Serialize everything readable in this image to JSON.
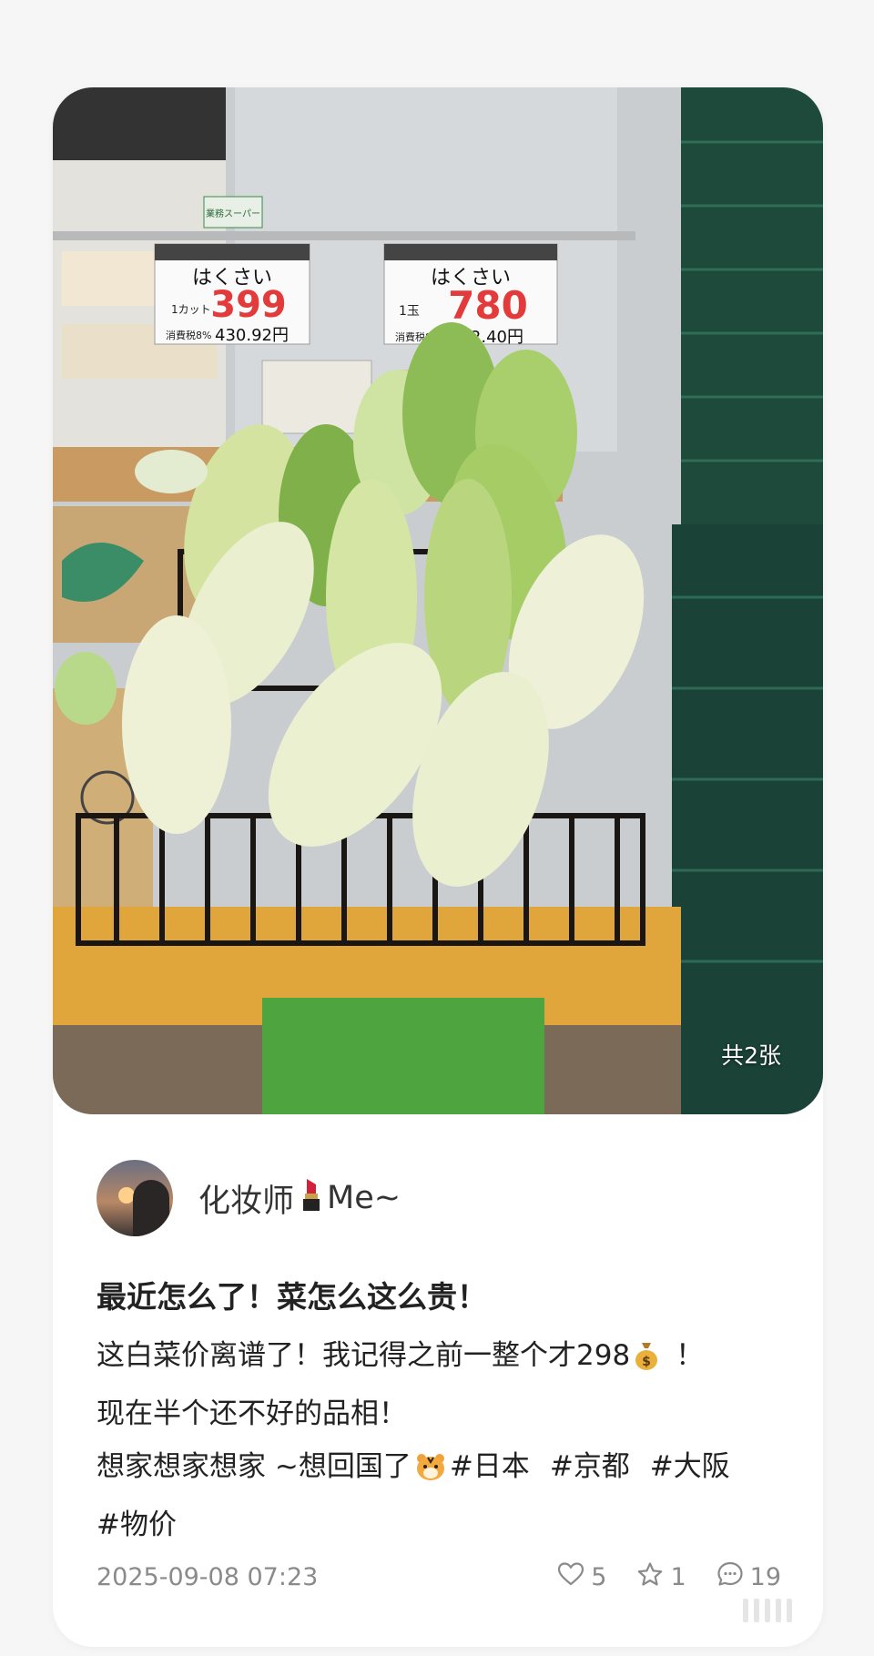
{
  "photo": {
    "count_label": "共2张",
    "price_tags": [
      {
        "name": "はくさい",
        "unit": "1カット",
        "price": "399",
        "tax_label": "消費税8%",
        "tax_price": "430.92円"
      },
      {
        "name": "はくさい",
        "unit": "1玉",
        "price": "780",
        "tax_label": "消費税8%",
        "tax_price": "842.40円"
      }
    ],
    "store_sign": "業務スーパー"
  },
  "author": {
    "name": "化妆师",
    "name_suffix": "Me~"
  },
  "post": {
    "title": "最近怎么了！菜怎么这么贵！",
    "line1_a": "这白菜价离谱了！我记得之前一整个才298",
    "line1_b": "！",
    "line2": "现在半个还不好的品相！",
    "line3_a": "想家想家想家 ~想回国了",
    "tags": [
      "#日本",
      "#京都",
      "#大阪"
    ],
    "line4_tag": "#物价"
  },
  "footer": {
    "timestamp": "2025-09-08 07:23",
    "likes": "5",
    "favorites": "1",
    "comments": "19"
  },
  "icons": {
    "lipstick": "lipstick-icon",
    "money_bag": "money-bag-icon",
    "tiger": "tiger-face-icon",
    "like": "heart-icon",
    "favorite": "star-icon",
    "comment": "comment-icon"
  }
}
